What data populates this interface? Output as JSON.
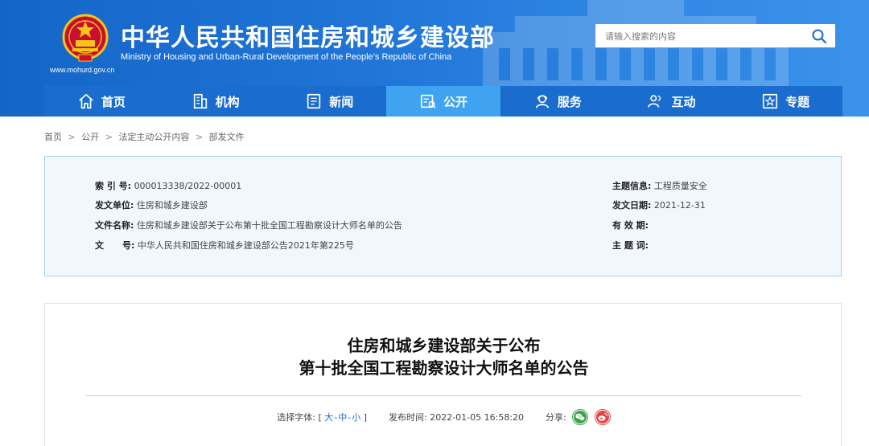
{
  "header": {
    "title": "中华人民共和国住房和城乡建设部",
    "subtitle": "Ministry of Housing and Urban-Rural Development of the People’s Republic of China",
    "url": "www.mohurd.gov.cn",
    "search_placeholder": "请输入搜索的内容",
    "banner_color": "#1f74d6"
  },
  "nav": {
    "items": [
      {
        "label": "首页",
        "icon": "home-icon"
      },
      {
        "label": "机构",
        "icon": "building-icon"
      },
      {
        "label": "新闻",
        "icon": "news-icon"
      },
      {
        "label": "公开",
        "icon": "open-icon",
        "active": true
      },
      {
        "label": "服务",
        "icon": "service-icon"
      },
      {
        "label": "互动",
        "icon": "interact-icon"
      },
      {
        "label": "专题",
        "icon": "topic-icon"
      }
    ],
    "active_color": "#3fa3f2"
  },
  "breadcrumb": [
    "首页",
    "公开",
    "法定主动公开内容",
    "部发文件"
  ],
  "info": {
    "index_label": "索 引 号:",
    "index_value": "000013338/2022-00001",
    "issuer_label": "发文单位:",
    "issuer_value": "住房和城乡建设部",
    "name_label": "文件名称:",
    "name_value": "住房和城乡建设部关于公布第十批全国工程勘察设计大师名单的公告",
    "doc_no_label": "文      号:",
    "doc_no_value": "中华人民共和国住房和城乡建设部公告2021年第225号",
    "topic_label": "主题信息:",
    "topic_value": "工程质量安全",
    "date_label": "发文日期:",
    "date_value": "2021-12-31",
    "validity_label": "有 效 期:",
    "validity_value": "",
    "keywords_label": "主 题 词:",
    "keywords_value": ""
  },
  "article": {
    "title_line1": "住房和城乡建设部关于公布",
    "title_line2": "第十批全国工程勘察设计大师名单的公告",
    "font_label": "选择字体:",
    "font_open": "[",
    "font_large": "大",
    "font_medium": "中",
    "font_small": "小",
    "font_close": "]",
    "publish_label": "发布时间:",
    "publish_time": "2022-01-05 16:58:20",
    "share_label": "分享:",
    "share_icons": [
      "wechat-icon",
      "weibo-icon"
    ]
  }
}
